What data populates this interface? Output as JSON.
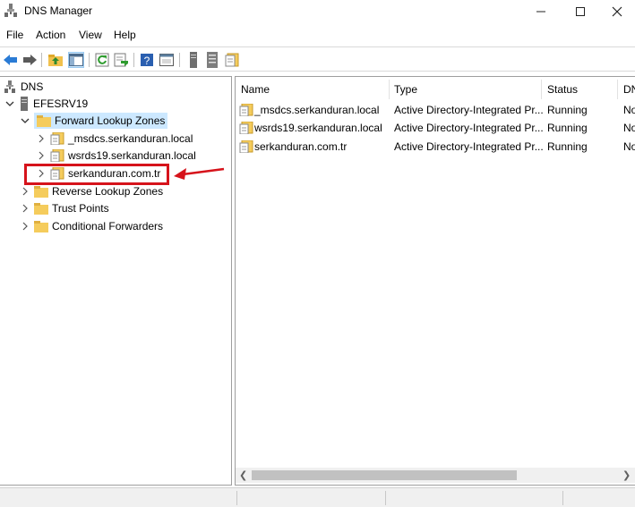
{
  "window": {
    "title": "DNS Manager"
  },
  "menu": [
    "File",
    "Action",
    "View",
    "Help"
  ],
  "toolbar": {
    "icons": [
      "back-arrow-icon",
      "forward-arrow-icon",
      "up-folder-icon",
      "show-hide-tree-icon",
      "refresh-icon",
      "export-list-icon",
      "help-icon",
      "properties-icon",
      "server-icon",
      "list-icon",
      "zone-icon"
    ]
  },
  "tree": {
    "root": "DNS",
    "server": "EFESRV19",
    "forward_lookup": "Forward Lookup Zones",
    "zones": [
      "_msdcs.serkanduran.local",
      "wsrds19.serkanduran.local",
      "serkanduran.com.tr"
    ],
    "reverse_lookup": "Reverse Lookup Zones",
    "trust_points": "Trust Points",
    "conditional_forwarders": "Conditional Forwarders"
  },
  "list": {
    "columns": [
      "Name",
      "Type",
      "Status",
      "DN"
    ],
    "rows": [
      {
        "name": "_msdcs.serkanduran.local",
        "type": "Active Directory-Integrated Pr...",
        "status": "Running",
        "dnssec": "No"
      },
      {
        "name": "wsrds19.serkanduran.local",
        "type": "Active Directory-Integrated Pr...",
        "status": "Running",
        "dnssec": "No"
      },
      {
        "name": "serkanduran.com.tr",
        "type": "Active Directory-Integrated Pr...",
        "status": "Running",
        "dnssec": "No"
      }
    ]
  },
  "colors": {
    "selection": "#cce8ff",
    "annotation_red": "#d6131b",
    "folder": "#f5cc5c"
  }
}
